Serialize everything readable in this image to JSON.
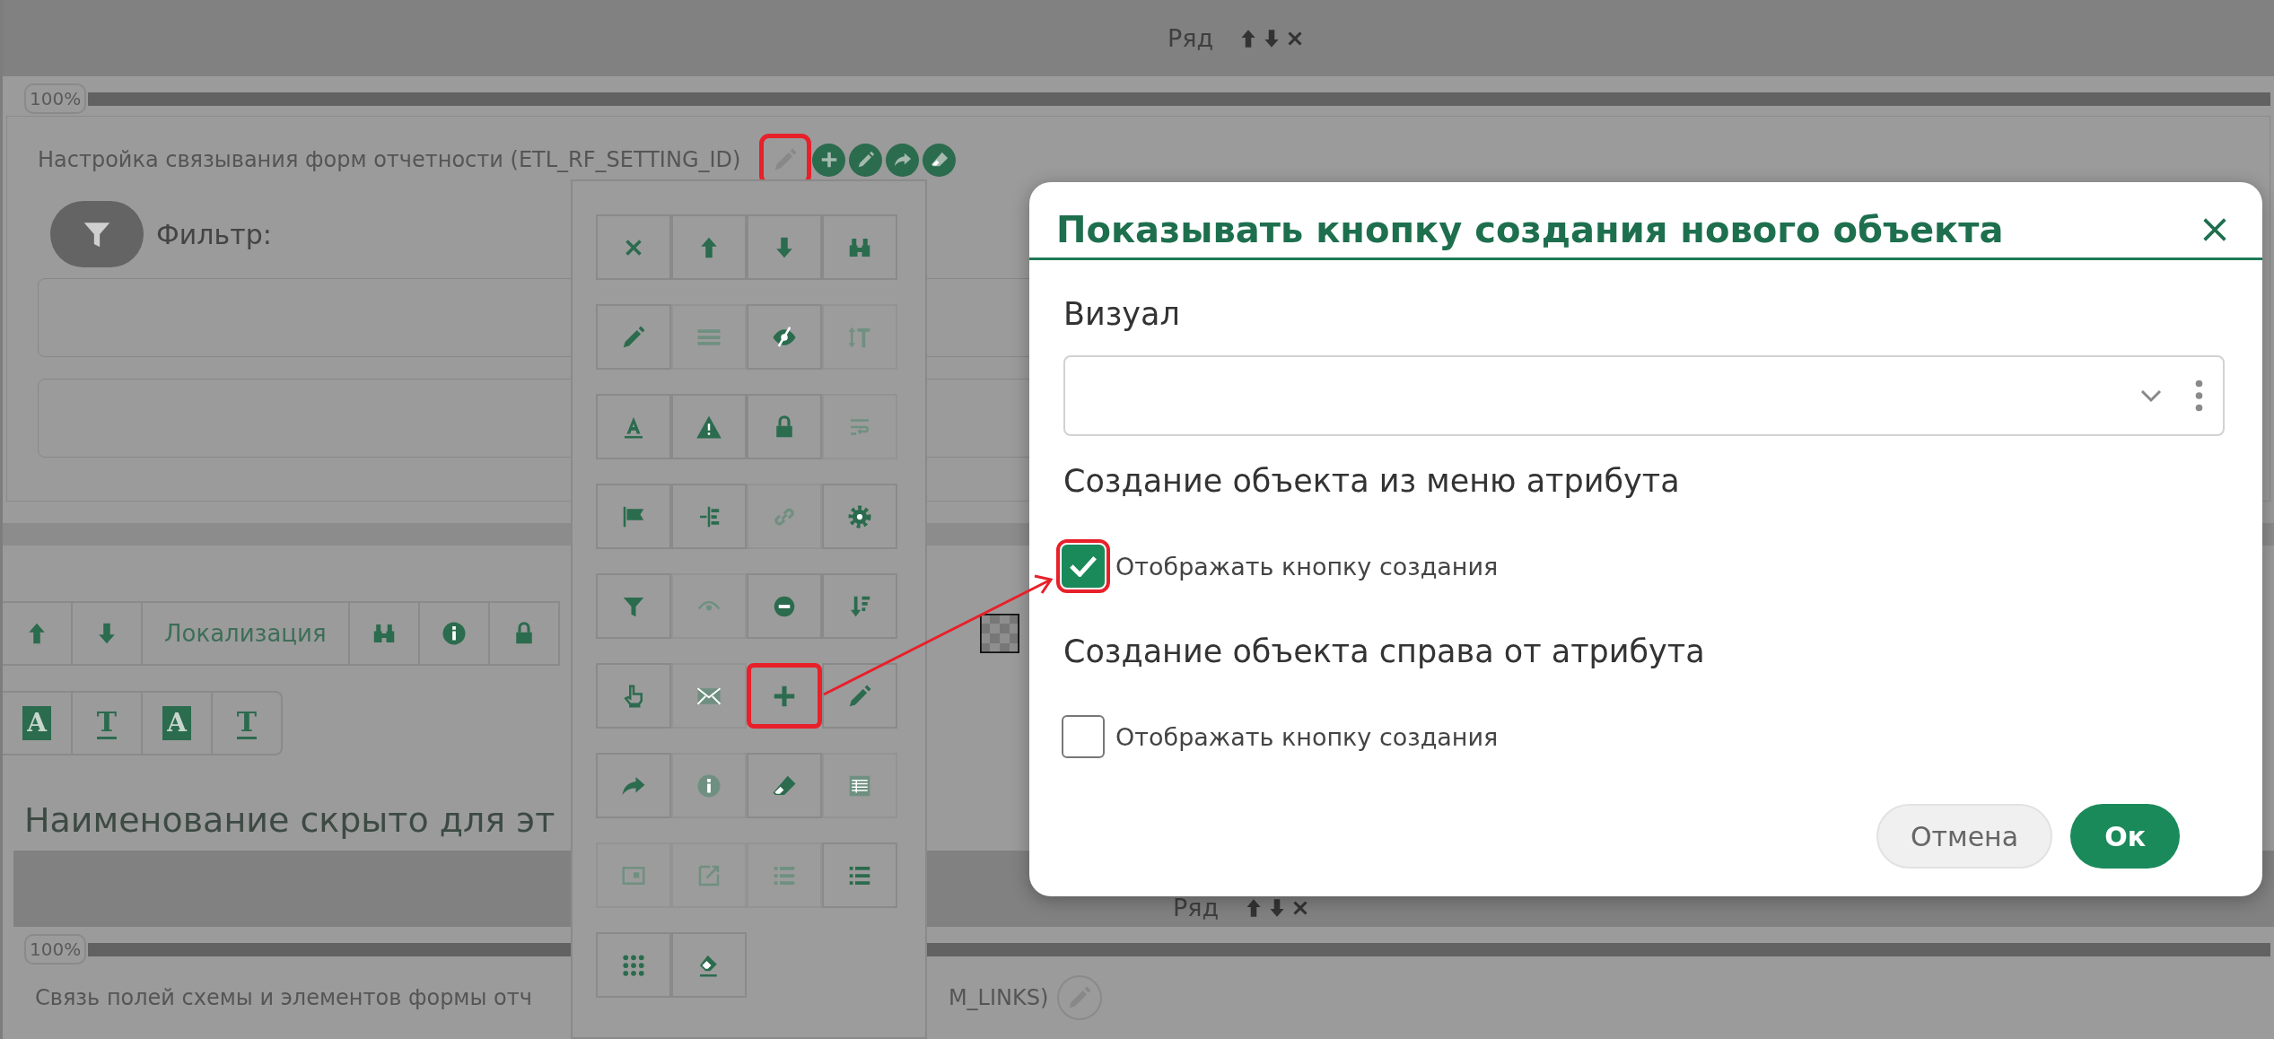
{
  "top_row": {
    "label": "Ряд"
  },
  "progress_1": {
    "label": "100%",
    "level": 1
  },
  "setting": {
    "title": "Настройка связывания форм отчетности (ETL_RF_SETTING_ID)",
    "edit_highlighted": true,
    "actions": [
      {
        "kind": "plus"
      },
      {
        "kind": "pencil"
      },
      {
        "kind": "share"
      },
      {
        "kind": "eraser"
      }
    ],
    "filter_label": "Фильтр:"
  },
  "toolbar": {
    "rows": [
      [
        {
          "kind": "up"
        },
        {
          "kind": "down"
        },
        {
          "kind": "text",
          "label": "Локализация"
        },
        {
          "kind": "binoculars"
        },
        {
          "kind": "info"
        },
        {
          "kind": "lock"
        },
        {
          "kind": "checker"
        }
      ],
      [
        {
          "kind": "glyph-box",
          "glyph": "A"
        },
        {
          "kind": "glyph-line",
          "glyph": "T"
        },
        {
          "kind": "glyph-box",
          "glyph": "A"
        },
        {
          "kind": "glyph-line",
          "glyph": "T"
        }
      ]
    ]
  },
  "heading": "Наименование скрыто для эт",
  "second_row": {
    "label": "Ряд"
  },
  "progress_2": {
    "label": "100%",
    "level": 1
  },
  "links": {
    "title_start": "Связь полей схемы и элементов формы отч",
    "title_end": "M_LINKS)"
  },
  "palette": {
    "buttons": [
      {
        "kind": "close",
        "disabled": false,
        "highlighted": false
      },
      {
        "kind": "up",
        "disabled": false,
        "highlighted": false
      },
      {
        "kind": "down",
        "disabled": false,
        "highlighted": false
      },
      {
        "kind": "binoculars",
        "disabled": false,
        "highlighted": false
      },
      {
        "kind": "pencil",
        "disabled": false,
        "highlighted": false
      },
      {
        "kind": "lines",
        "disabled": true,
        "highlighted": false
      },
      {
        "kind": "eye-slash",
        "disabled": false,
        "highlighted": false
      },
      {
        "kind": "text-height",
        "disabled": true,
        "highlighted": false
      },
      {
        "kind": "font",
        "disabled": false,
        "highlighted": false
      },
      {
        "kind": "warning",
        "disabled": false,
        "highlighted": false
      },
      {
        "kind": "lock",
        "disabled": false,
        "highlighted": false
      },
      {
        "kind": "wrap",
        "disabled": true,
        "highlighted": false
      },
      {
        "kind": "flag",
        "disabled": false,
        "highlighted": false
      },
      {
        "kind": "indent",
        "disabled": false,
        "highlighted": false
      },
      {
        "kind": "link",
        "disabled": true,
        "highlighted": false
      },
      {
        "kind": "gear",
        "disabled": false,
        "highlighted": false
      },
      {
        "kind": "filter",
        "disabled": false,
        "highlighted": false
      },
      {
        "kind": "eye",
        "disabled": true,
        "highlighted": false
      },
      {
        "kind": "minus",
        "disabled": false,
        "highlighted": false
      },
      {
        "kind": "sort",
        "disabled": false,
        "highlighted": false
      },
      {
        "kind": "hand",
        "disabled": false,
        "highlighted": false
      },
      {
        "kind": "envelope",
        "disabled": true,
        "highlighted": false
      },
      {
        "kind": "plus",
        "disabled": false,
        "highlighted": true
      },
      {
        "kind": "pencil",
        "disabled": false,
        "highlighted": false
      },
      {
        "kind": "share",
        "disabled": false,
        "highlighted": false
      },
      {
        "kind": "info",
        "disabled": true,
        "highlighted": false
      },
      {
        "kind": "eraser",
        "disabled": false,
        "highlighted": false
      },
      {
        "kind": "table",
        "disabled": true,
        "highlighted": false
      },
      {
        "kind": "window",
        "disabled": true,
        "highlighted": false
      },
      {
        "kind": "external",
        "disabled": true,
        "highlighted": false
      },
      {
        "kind": "bullets",
        "disabled": true,
        "highlighted": false
      },
      {
        "kind": "bullets",
        "disabled": false,
        "highlighted": false
      },
      {
        "kind": "grid",
        "disabled": false,
        "highlighted": false
      },
      {
        "kind": "eraser-line",
        "disabled": false,
        "highlighted": false
      }
    ]
  },
  "dialog": {
    "title": "Показывать кнопку создания нового объекта",
    "field_label": "Визуал",
    "sections": [
      {
        "heading": "Создание объекта из меню атрибута",
        "checkbox": {
          "label": "Отображать кнопку создания",
          "checked": true,
          "highlighted": true
        }
      },
      {
        "heading": "Создание объекта справа от атрибута",
        "checkbox": {
          "label": "Отображать кнопку создания",
          "checked": false,
          "highlighted": false
        }
      }
    ],
    "buttons": [
      {
        "label": "Отмена",
        "kind": "secondary"
      },
      {
        "label": "Ок",
        "kind": "primary"
      }
    ]
  },
  "callout_arrow": true
}
